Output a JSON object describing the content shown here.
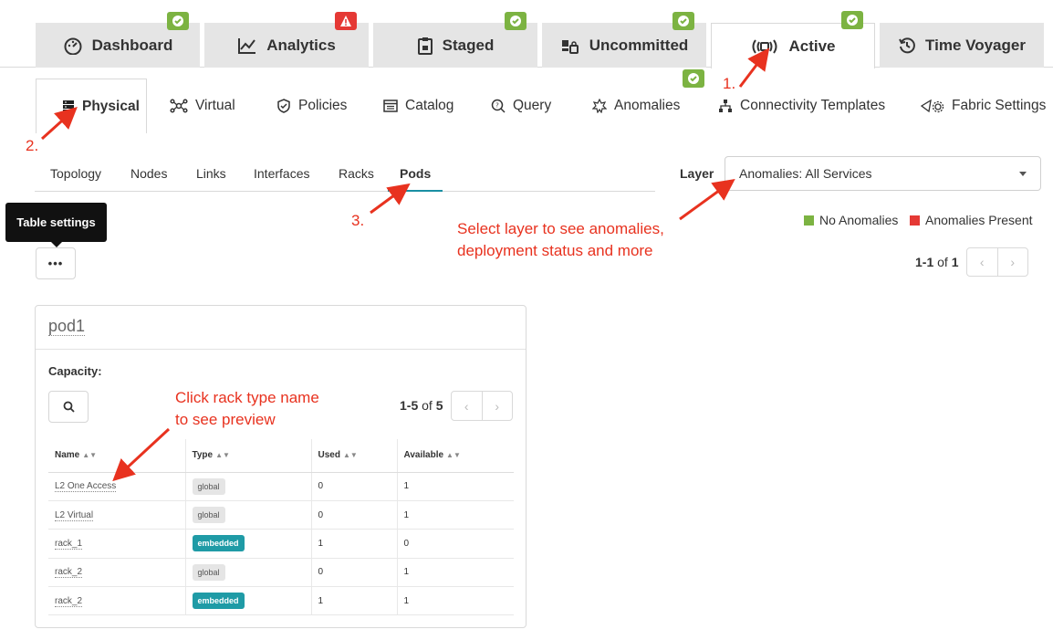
{
  "top_tabs": [
    {
      "label": "Dashboard",
      "icon": "dashboard-icon",
      "badge": "ok"
    },
    {
      "label": "Analytics",
      "icon": "analytics-icon",
      "badge": "warn"
    },
    {
      "label": "Staged",
      "icon": "staged-icon",
      "badge": "ok"
    },
    {
      "label": "Uncommitted",
      "icon": "uncommitted-icon",
      "badge": "ok"
    },
    {
      "label": "Active",
      "icon": "active-icon",
      "badge": "ok",
      "active": true
    },
    {
      "label": "Time Voyager",
      "icon": "time-voyager-icon"
    }
  ],
  "secondary_tabs": [
    {
      "label": "Physical",
      "icon": "physical-icon",
      "active": true
    },
    {
      "label": "Virtual",
      "icon": "virtual-icon"
    },
    {
      "label": "Policies",
      "icon": "policies-icon"
    },
    {
      "label": "Catalog",
      "icon": "catalog-icon"
    },
    {
      "label": "Query",
      "icon": "query-icon"
    },
    {
      "label": "Anomalies",
      "icon": "anomalies-icon"
    },
    {
      "label": "Connectivity Templates",
      "icon": "connectivity-icon",
      "badge": "ok"
    },
    {
      "label": "Fabric Settings",
      "icon": "fabric-settings-icon"
    }
  ],
  "sub_tabs": [
    {
      "label": "Topology"
    },
    {
      "label": "Nodes"
    },
    {
      "label": "Links"
    },
    {
      "label": "Interfaces"
    },
    {
      "label": "Racks"
    },
    {
      "label": "Pods",
      "active": true
    }
  ],
  "layer": {
    "label": "Layer",
    "value": "Anomalies: All Services"
  },
  "legend": [
    {
      "label": "No Anomalies",
      "color": "#7cb342"
    },
    {
      "label": "Anomalies Present",
      "color": "#e53935"
    }
  ],
  "table_settings": {
    "tooltip": "Table settings",
    "button": "•••"
  },
  "pager_main": {
    "range": "1-1",
    "of": "of",
    "total": "1"
  },
  "pod": {
    "name": "pod1",
    "capacity_label": "Capacity:",
    "pager": {
      "range": "1-5",
      "of": "of",
      "total": "5"
    },
    "columns": [
      "Name",
      "Type",
      "Used",
      "Available"
    ],
    "rows": [
      {
        "name": "L2 One Access",
        "type": "global",
        "used": "0",
        "available": "1"
      },
      {
        "name": "L2 Virtual",
        "type": "global",
        "used": "0",
        "available": "1"
      },
      {
        "name": "rack_1",
        "type": "embedded",
        "used": "1",
        "available": "0"
      },
      {
        "name": "rack_2",
        "type": "global",
        "used": "0",
        "available": "1"
      },
      {
        "name": "rack_2",
        "type": "embedded",
        "used": "1",
        "available": "1"
      }
    ]
  },
  "annotations": {
    "n1": "1.",
    "n2": "2.",
    "n3": "3.",
    "layer_hint": "Select layer to see anomalies,",
    "layer_hint2": "deployment status and more",
    "rack_hint": "Click rack type name",
    "rack_hint2": "to see preview"
  },
  "colors": {
    "accent": "#1a8fa3",
    "ok": "#7cb342",
    "warn": "#e53935",
    "annotation": "#e8321f"
  }
}
